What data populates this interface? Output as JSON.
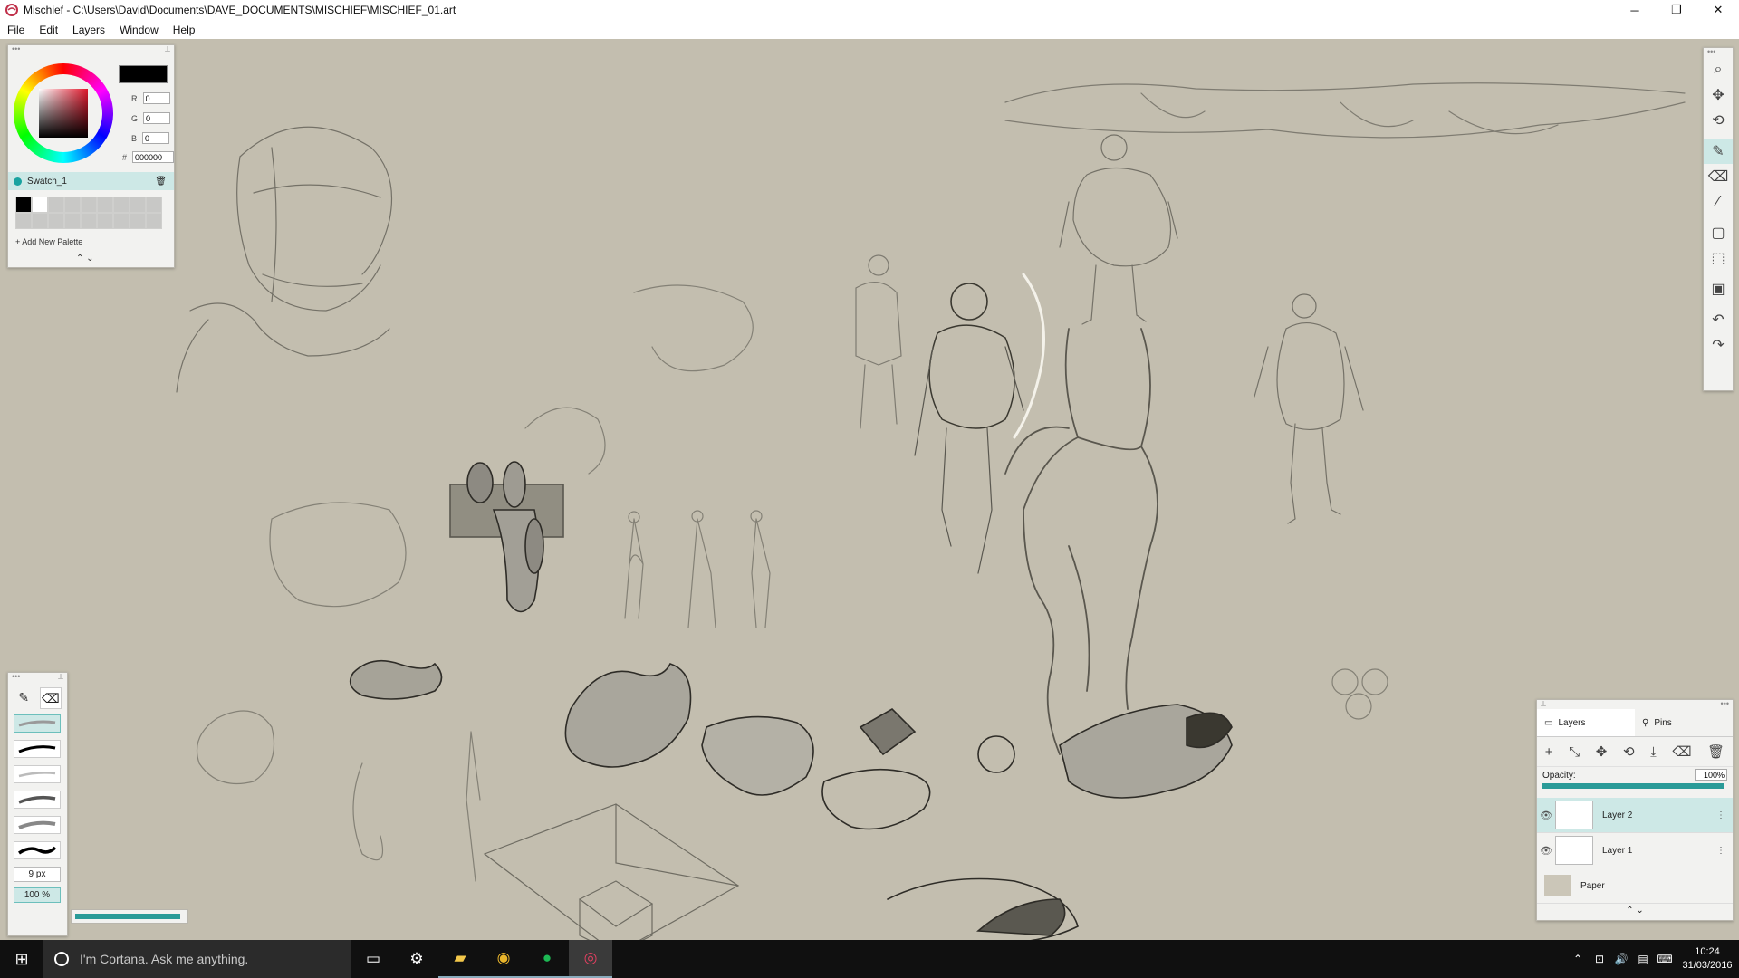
{
  "window": {
    "title": "Mischief - C:\\Users\\David\\Documents\\DAVE_DOCUMENTS\\MISCHIEF\\MISCHIEF_01.art",
    "min_icon": "minimize-icon",
    "max_icon": "restore-icon",
    "close_icon": "close-icon"
  },
  "menu": [
    "File",
    "Edit",
    "Layers",
    "Window",
    "Help"
  ],
  "color_panel": {
    "current_color": "#000000",
    "r_label": "R",
    "r": "0",
    "g_label": "G",
    "g": "0",
    "b_label": "B",
    "b": "0",
    "hex_label": "#",
    "hex": "000000",
    "swatch_name": "Swatch_1",
    "add_palette": "+ Add New Palette",
    "arrows": "⌃ ⌄"
  },
  "brush_panel": {
    "size": "9 px",
    "opacity": "100 %",
    "opacity_fraction": 1.0
  },
  "layers_panel": {
    "tab_layers": "Layers",
    "tab_pins": "Pins",
    "opacity_label": "Opacity:",
    "opacity_value": "100%",
    "layers": [
      {
        "name": "Layer 2",
        "selected": true
      },
      {
        "name": "Layer 1",
        "selected": false
      }
    ],
    "paper_label": "Paper",
    "arrows": "⌃ ⌄"
  },
  "taskbar": {
    "cortana_placeholder": "I'm Cortana. Ask me anything.",
    "time": "10:24",
    "date": "31/03/2016"
  },
  "colors": {
    "accent": "#2a9b98",
    "canvas": "#c3beaf",
    "selection": "#cde8e6"
  }
}
